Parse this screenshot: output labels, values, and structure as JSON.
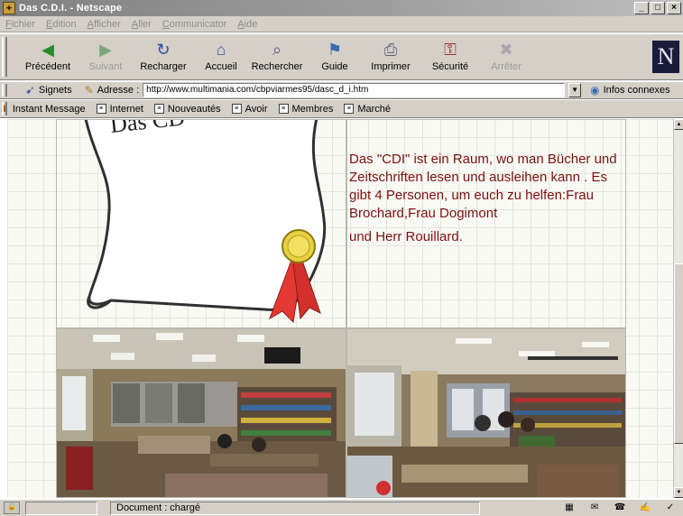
{
  "window": {
    "title": "Das C.D.I. - Netscape",
    "buttons": {
      "minimize": "_",
      "maximize": "□",
      "close": "×"
    }
  },
  "menu": [
    "Fichier",
    "Edition",
    "Afficher",
    "Aller",
    "Communicator",
    "Aide"
  ],
  "nav": [
    {
      "label": "Précédent",
      "icon": "back-arrow-icon",
      "glyph": "◀",
      "color": "#2a8a2a",
      "enabled": true
    },
    {
      "label": "Suivant",
      "icon": "forward-arrow-icon",
      "glyph": "▶",
      "color": "#7aa87a",
      "enabled": false
    },
    {
      "label": "Recharger",
      "icon": "reload-icon",
      "glyph": "↻",
      "color": "#2a4aa0",
      "enabled": true
    },
    {
      "label": "Accueil",
      "icon": "home-icon",
      "glyph": "⌂",
      "color": "#3a5aa8",
      "enabled": true
    },
    {
      "label": "Rechercher",
      "icon": "search-icon",
      "glyph": "⌕",
      "color": "#5a5a9a",
      "enabled": true
    },
    {
      "label": "Guide",
      "icon": "guide-icon",
      "glyph": "⚑",
      "color": "#3a6ab0",
      "enabled": true
    },
    {
      "label": "Imprimer",
      "icon": "printer-icon",
      "glyph": "⎙",
      "color": "#606078",
      "enabled": true
    },
    {
      "label": "Sécurité",
      "icon": "lock-icon",
      "glyph": "⚿",
      "color": "#a03030",
      "enabled": true
    },
    {
      "label": "Arrêter",
      "icon": "stop-icon",
      "glyph": "✖",
      "color": "#b0a0b0",
      "enabled": false
    }
  ],
  "location": {
    "bookmarks_label": "Signets",
    "address_label": "Adresse :",
    "url": "http://www.multimania.com/cbpviarmes95/dasc_d_i.htm",
    "related_label": "Infos connexes"
  },
  "personal_toolbar": [
    "Instant Message",
    "Internet",
    "Nouveautés",
    "Avoir",
    "Membres",
    "Marché"
  ],
  "page": {
    "scroll_title": "Das CD",
    "paragraph1": "Das \"CDI\" ist ein Raum, wo man Bücher und Zeitschriften lesen und ausleihen kann . Es gibt 4 Personen, um euch zu helfen:Frau Brochard,Frau Dogimont",
    "paragraph2": "und Herr Rouillard.",
    "text_color": "#7a1010"
  },
  "status": {
    "text": "Document : chargé"
  }
}
